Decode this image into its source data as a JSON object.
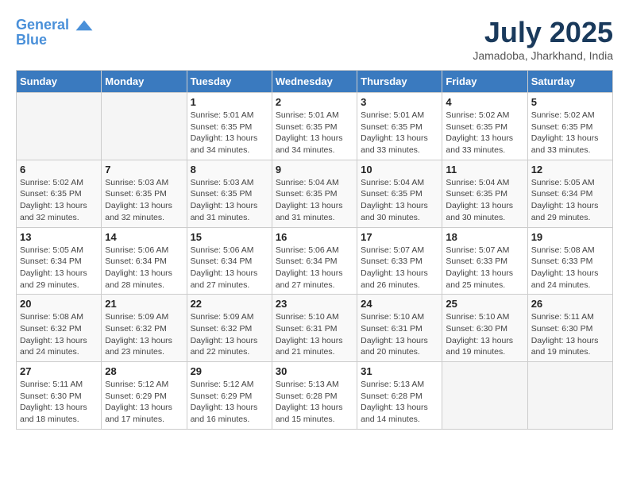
{
  "header": {
    "logo_line1": "General",
    "logo_line2": "Blue",
    "month_year": "July 2025",
    "location": "Jamadoba, Jharkhand, India"
  },
  "columns": [
    "Sunday",
    "Monday",
    "Tuesday",
    "Wednesday",
    "Thursday",
    "Friday",
    "Saturday"
  ],
  "weeks": [
    [
      {
        "day": "",
        "detail": ""
      },
      {
        "day": "",
        "detail": ""
      },
      {
        "day": "1",
        "detail": "Sunrise: 5:01 AM\nSunset: 6:35 PM\nDaylight: 13 hours\nand 34 minutes."
      },
      {
        "day": "2",
        "detail": "Sunrise: 5:01 AM\nSunset: 6:35 PM\nDaylight: 13 hours\nand 34 minutes."
      },
      {
        "day": "3",
        "detail": "Sunrise: 5:01 AM\nSunset: 6:35 PM\nDaylight: 13 hours\nand 33 minutes."
      },
      {
        "day": "4",
        "detail": "Sunrise: 5:02 AM\nSunset: 6:35 PM\nDaylight: 13 hours\nand 33 minutes."
      },
      {
        "day": "5",
        "detail": "Sunrise: 5:02 AM\nSunset: 6:35 PM\nDaylight: 13 hours\nand 33 minutes."
      }
    ],
    [
      {
        "day": "6",
        "detail": "Sunrise: 5:02 AM\nSunset: 6:35 PM\nDaylight: 13 hours\nand 32 minutes."
      },
      {
        "day": "7",
        "detail": "Sunrise: 5:03 AM\nSunset: 6:35 PM\nDaylight: 13 hours\nand 32 minutes."
      },
      {
        "day": "8",
        "detail": "Sunrise: 5:03 AM\nSunset: 6:35 PM\nDaylight: 13 hours\nand 31 minutes."
      },
      {
        "day": "9",
        "detail": "Sunrise: 5:04 AM\nSunset: 6:35 PM\nDaylight: 13 hours\nand 31 minutes."
      },
      {
        "day": "10",
        "detail": "Sunrise: 5:04 AM\nSunset: 6:35 PM\nDaylight: 13 hours\nand 30 minutes."
      },
      {
        "day": "11",
        "detail": "Sunrise: 5:04 AM\nSunset: 6:35 PM\nDaylight: 13 hours\nand 30 minutes."
      },
      {
        "day": "12",
        "detail": "Sunrise: 5:05 AM\nSunset: 6:34 PM\nDaylight: 13 hours\nand 29 minutes."
      }
    ],
    [
      {
        "day": "13",
        "detail": "Sunrise: 5:05 AM\nSunset: 6:34 PM\nDaylight: 13 hours\nand 29 minutes."
      },
      {
        "day": "14",
        "detail": "Sunrise: 5:06 AM\nSunset: 6:34 PM\nDaylight: 13 hours\nand 28 minutes."
      },
      {
        "day": "15",
        "detail": "Sunrise: 5:06 AM\nSunset: 6:34 PM\nDaylight: 13 hours\nand 27 minutes."
      },
      {
        "day": "16",
        "detail": "Sunrise: 5:06 AM\nSunset: 6:34 PM\nDaylight: 13 hours\nand 27 minutes."
      },
      {
        "day": "17",
        "detail": "Sunrise: 5:07 AM\nSunset: 6:33 PM\nDaylight: 13 hours\nand 26 minutes."
      },
      {
        "day": "18",
        "detail": "Sunrise: 5:07 AM\nSunset: 6:33 PM\nDaylight: 13 hours\nand 25 minutes."
      },
      {
        "day": "19",
        "detail": "Sunrise: 5:08 AM\nSunset: 6:33 PM\nDaylight: 13 hours\nand 24 minutes."
      }
    ],
    [
      {
        "day": "20",
        "detail": "Sunrise: 5:08 AM\nSunset: 6:32 PM\nDaylight: 13 hours\nand 24 minutes."
      },
      {
        "day": "21",
        "detail": "Sunrise: 5:09 AM\nSunset: 6:32 PM\nDaylight: 13 hours\nand 23 minutes."
      },
      {
        "day": "22",
        "detail": "Sunrise: 5:09 AM\nSunset: 6:32 PM\nDaylight: 13 hours\nand 22 minutes."
      },
      {
        "day": "23",
        "detail": "Sunrise: 5:10 AM\nSunset: 6:31 PM\nDaylight: 13 hours\nand 21 minutes."
      },
      {
        "day": "24",
        "detail": "Sunrise: 5:10 AM\nSunset: 6:31 PM\nDaylight: 13 hours\nand 20 minutes."
      },
      {
        "day": "25",
        "detail": "Sunrise: 5:10 AM\nSunset: 6:30 PM\nDaylight: 13 hours\nand 19 minutes."
      },
      {
        "day": "26",
        "detail": "Sunrise: 5:11 AM\nSunset: 6:30 PM\nDaylight: 13 hours\nand 19 minutes."
      }
    ],
    [
      {
        "day": "27",
        "detail": "Sunrise: 5:11 AM\nSunset: 6:30 PM\nDaylight: 13 hours\nand 18 minutes."
      },
      {
        "day": "28",
        "detail": "Sunrise: 5:12 AM\nSunset: 6:29 PM\nDaylight: 13 hours\nand 17 minutes."
      },
      {
        "day": "29",
        "detail": "Sunrise: 5:12 AM\nSunset: 6:29 PM\nDaylight: 13 hours\nand 16 minutes."
      },
      {
        "day": "30",
        "detail": "Sunrise: 5:13 AM\nSunset: 6:28 PM\nDaylight: 13 hours\nand 15 minutes."
      },
      {
        "day": "31",
        "detail": "Sunrise: 5:13 AM\nSunset: 6:28 PM\nDaylight: 13 hours\nand 14 minutes."
      },
      {
        "day": "",
        "detail": ""
      },
      {
        "day": "",
        "detail": ""
      }
    ]
  ]
}
